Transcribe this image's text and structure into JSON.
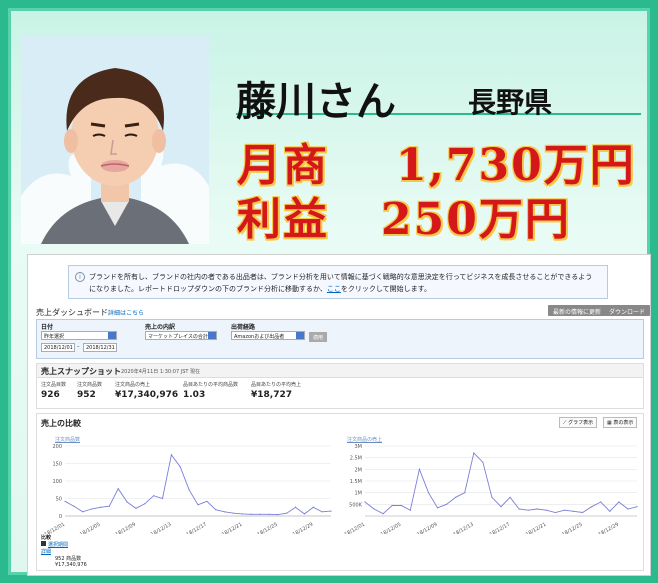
{
  "profile": {
    "name": "藤川さん",
    "prefecture": "長野県",
    "monthly_sales_label": "月商",
    "monthly_sales_value": "1,730万円",
    "profit_label": "利益",
    "profit_value": "250万円"
  },
  "notice": {
    "text1": "ブランドを所有し、ブランドの社内の者である出品者は、ブランド分析を用いて情報に基づく戦略的な意思決定を行ってビジネスを成長させることができるようになりました。レポートドロップダウンの下のブランド分析に移動するか、",
    "link": "ここ",
    "text2": "をクリックして開始します。"
  },
  "dashboard": {
    "title": "売上ダッシュボード",
    "detail_link": "詳細はこちら",
    "refresh_button": "最新の情報に更新",
    "download_button": "ダウンロード"
  },
  "filters": {
    "date_label": "日付",
    "date_value": "昨年選択",
    "date_from": "2018/12/01",
    "date_sep": "–",
    "date_to": "2018/12/31",
    "sales_label": "売上の内訳",
    "sales_value": "マーケットプレイスの合計",
    "channel_label": "出荷経路",
    "channel_value": "Amazonおよび出品者",
    "apply_button": "適用"
  },
  "snapshot": {
    "title": "売上スナップショット",
    "time": "2020年4月11日 1:30:07 JST 現在",
    "metrics": [
      {
        "label": "注文品目数",
        "value": "926"
      },
      {
        "label": "注文商品数",
        "value": "952"
      },
      {
        "label": "注文商品の売上",
        "value": "¥17,340,976"
      },
      {
        "label": "品目あたりの平均商品数",
        "value": "1.03"
      },
      {
        "label": "品目あたりの平均売上",
        "value": "¥18,727"
      }
    ]
  },
  "compare": {
    "title": "売上の比較",
    "graph_button": "グラフ表示",
    "table_button": "表の表示",
    "legend_title": "比較",
    "legend_detail": "詳細",
    "legend_series": "選択期間",
    "legend_units": "952 商品数",
    "legend_sales": "¥17,340,976"
  },
  "chart_data": [
    {
      "type": "line",
      "title": "注文商品数",
      "x": [
        "18/12/01",
        "18/12/02",
        "18/12/03",
        "18/12/04",
        "18/12/05",
        "18/12/06",
        "18/12/07",
        "18/12/08",
        "18/12/09",
        "18/12/10",
        "18/12/11",
        "18/12/12",
        "18/12/13",
        "18/12/14",
        "18/12/15",
        "18/12/16",
        "18/12/17",
        "18/12/18",
        "18/12/19",
        "18/12/20",
        "18/12/21",
        "18/12/22",
        "18/12/23",
        "18/12/24",
        "18/12/25",
        "18/12/26",
        "18/12/27",
        "18/12/28",
        "18/12/29",
        "18/12/30",
        "18/12/31"
      ],
      "x_ticks": [
        "18/12/01",
        "18/12/05",
        "18/12/09",
        "18/12/13",
        "18/12/17",
        "18/12/21",
        "18/12/25",
        "18/12/29"
      ],
      "values": [
        42,
        28,
        12,
        20,
        25,
        28,
        78,
        40,
        22,
        35,
        58,
        50,
        175,
        140,
        75,
        32,
        42,
        18,
        12,
        8,
        6,
        5,
        5,
        5,
        4,
        8,
        25,
        6,
        25,
        12,
        14
      ],
      "ylim": [
        0,
        200
      ],
      "y_ticks": [
        "0",
        "50",
        "100",
        "150",
        "200"
      ],
      "color": "#7b7fd6"
    },
    {
      "type": "line",
      "title": "注文商品の売上",
      "x": [
        "18/12/01",
        "18/12/02",
        "18/12/03",
        "18/12/04",
        "18/12/05",
        "18/12/06",
        "18/12/07",
        "18/12/08",
        "18/12/09",
        "18/12/10",
        "18/12/11",
        "18/12/12",
        "18/12/13",
        "18/12/14",
        "18/12/15",
        "18/12/16",
        "18/12/17",
        "18/12/18",
        "18/12/19",
        "18/12/20",
        "18/12/21",
        "18/12/22",
        "18/12/23",
        "18/12/24",
        "18/12/25",
        "18/12/26",
        "18/12/27",
        "18/12/28",
        "18/12/29",
        "18/12/30",
        "18/12/31"
      ],
      "x_ticks": [
        "18/12/01",
        "18/12/05",
        "18/12/09",
        "18/12/13",
        "18/12/17",
        "18/12/21",
        "18/12/25",
        "18/12/29"
      ],
      "values": [
        600000,
        300000,
        100000,
        450000,
        450000,
        250000,
        2000000,
        1000000,
        350000,
        500000,
        800000,
        1000000,
        2700000,
        2300000,
        800000,
        400000,
        800000,
        300000,
        250000,
        300000,
        250000,
        150000,
        250000,
        200000,
        150000,
        400000,
        600000,
        200000,
        600000,
        300000,
        400000
      ],
      "ylim": [
        0,
        3000000
      ],
      "y_ticks": [
        "500K",
        "1M",
        "1.5M",
        "2M",
        "2.5M",
        "3M"
      ],
      "color": "#7b7fd6"
    }
  ]
}
